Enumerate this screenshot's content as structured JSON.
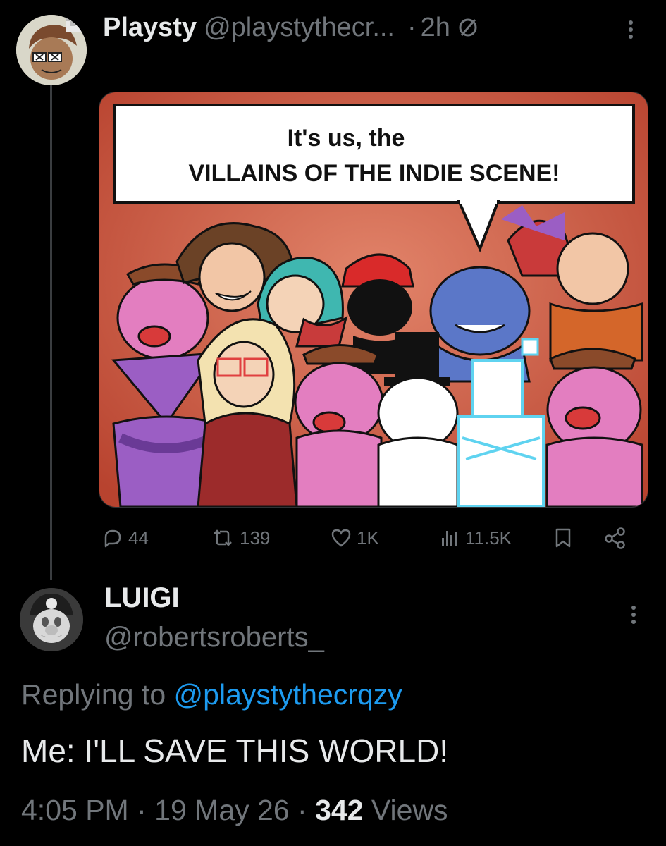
{
  "post": {
    "author_name": "Playsty",
    "author_handle": "@playstythecr...",
    "separator": "·",
    "time_ago": "2h",
    "grok_icon": "grok-icon",
    "more_icon": "more-vertical-icon",
    "image": {
      "speech_line1": "It's us, the",
      "speech_line2": "VILLAINS OF THE INDIE SCENE!",
      "background_color": "#c9553f"
    },
    "actions": {
      "replies": "44",
      "reposts": "139",
      "likes": "1K",
      "views": "11.5K"
    }
  },
  "reply": {
    "author_name": "LUIGI",
    "author_handle": "@robertsroberts_",
    "replying_to_label": "Replying to",
    "replying_to_handle": "@playstythecrqzy",
    "text": "Me: I'LL SAVE THIS WORLD!",
    "time": "4:05 PM",
    "date": "19 May 26",
    "dot": "·",
    "views_count": "342",
    "views_label": "Views"
  },
  "colors": {
    "background": "#000000",
    "text_primary": "#e7e9ea",
    "text_secondary": "#71767b",
    "link": "#1d9bf0"
  }
}
